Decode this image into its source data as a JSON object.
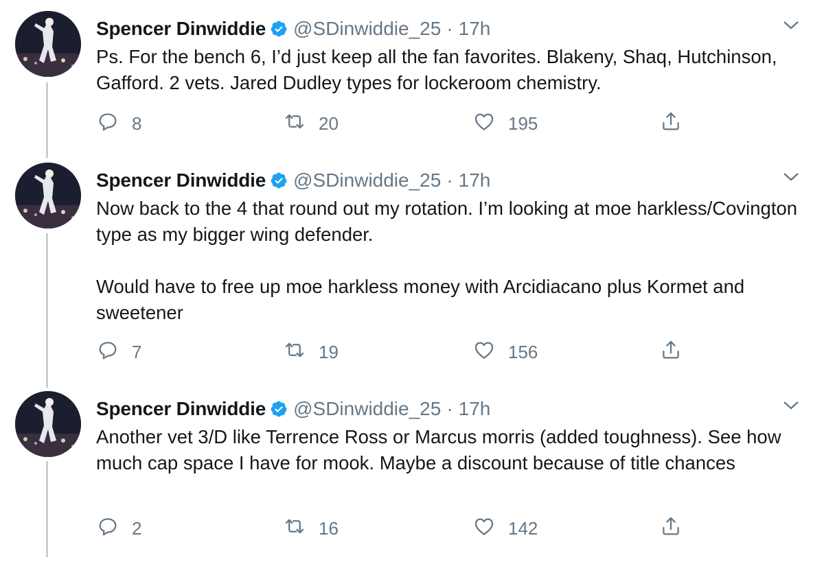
{
  "tweets": [
    {
      "name": "Spencer Dinwiddie",
      "handle": "@SDinwiddie_25",
      "separator": "·",
      "time": "17h",
      "text": [
        "Ps. For the bench 6, I’d just keep all the fan favorites. Blakeny, Shaq, Hutchinson, Gafford. 2 vets. Jared Dudley types for lockeroom chemistry."
      ],
      "replies": "8",
      "retweets": "20",
      "likes": "195"
    },
    {
      "name": "Spencer Dinwiddie",
      "handle": "@SDinwiddie_25",
      "separator": "·",
      "time": "17h",
      "text": [
        "Now back to the 4 that round out my rotation. I’m looking at moe harkless/Covington type as my bigger wing defender.",
        "Would have to free up moe harkless money with Arcidiacano plus Kormet and sweetener"
      ],
      "replies": "7",
      "retweets": "19",
      "likes": "156"
    },
    {
      "name": "Spencer Dinwiddie",
      "handle": "@SDinwiddie_25",
      "separator": "·",
      "time": "17h",
      "text": [
        "Another vet 3/D like Terrence Ross or Marcus morris (added toughness). See how much cap space I have for mook. Maybe a discount because of title chances"
      ],
      "replies": "2",
      "retweets": "16",
      "likes": "142"
    }
  ],
  "icons": {
    "reply": "reply-icon",
    "retweet": "retweet-icon",
    "like": "heart-icon",
    "share": "share-icon",
    "verified": "verified-badge-icon",
    "more": "chevron-down-icon"
  },
  "colors": {
    "verified": "#1da1f2",
    "muted": "#657786",
    "thread_line": "#c4cfd6"
  }
}
